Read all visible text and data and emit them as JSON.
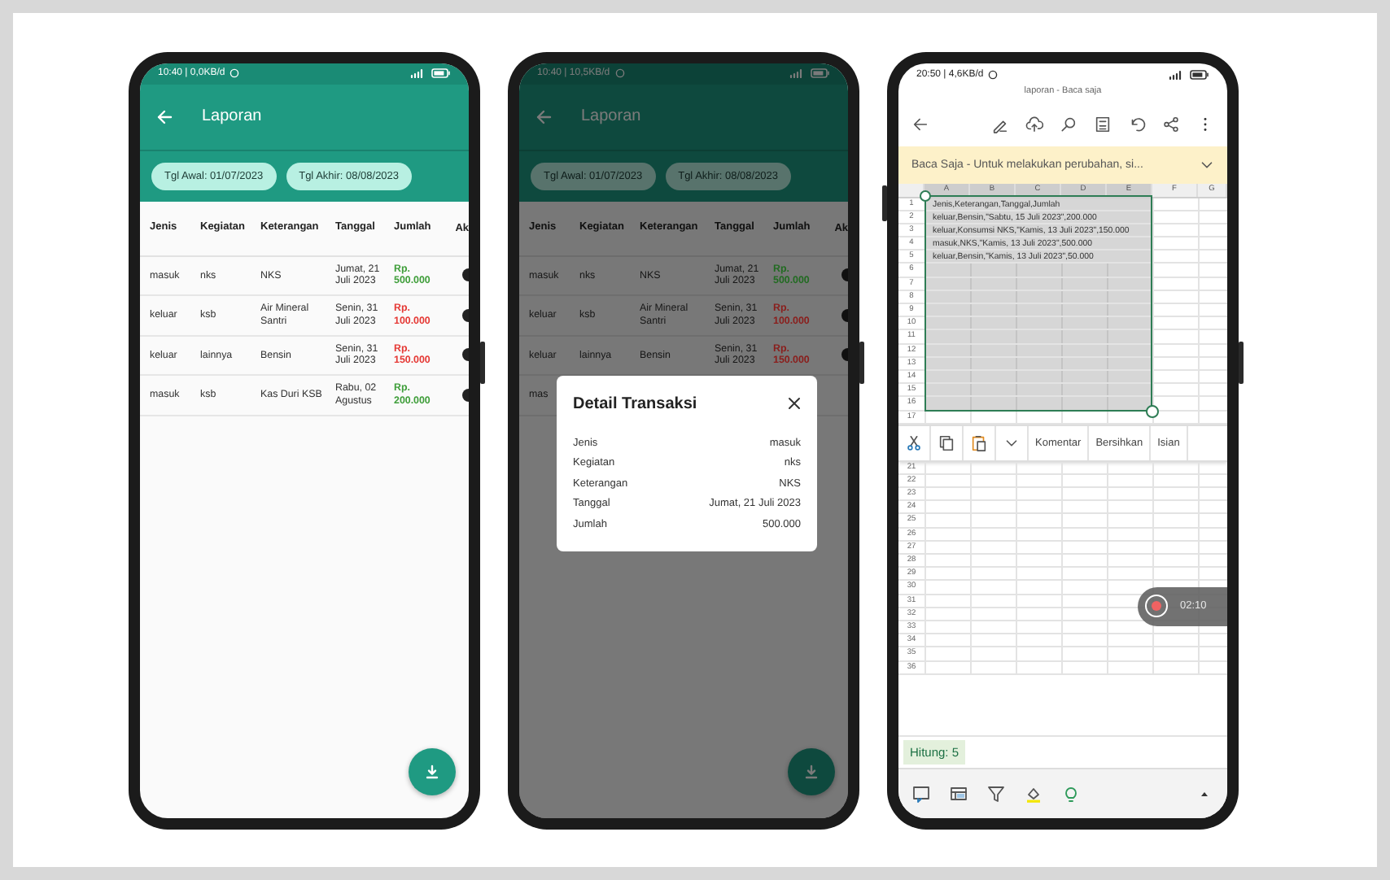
{
  "phones": [
    {
      "kind": "report",
      "dimmed": false,
      "status_bar": {
        "time": "10:40 | 0,0KB/d"
      },
      "app_bar": {
        "title": "Laporan"
      },
      "date_filters": [
        {
          "label": "Tgl Awal: 01/07/2023"
        },
        {
          "label": "Tgl Akhir: 08/08/2023"
        }
      ],
      "table": {
        "columns": [
          "Jenis",
          "Kegiatan",
          "Keterangan",
          "Tanggal",
          "Jumlah",
          "Ak"
        ],
        "rows": [
          {
            "jenis": "masuk",
            "kegiatan": "nks",
            "keterangan": "NKS",
            "tanggal": "Jumat, 21 Juli 2023",
            "jumlah": "Rp. 500.000",
            "color": "#3f9e3a"
          },
          {
            "jenis": "keluar",
            "kegiatan": "ksb",
            "keterangan": "Air Mineral Santri",
            "tanggal": "Senin, 31 Juli 2023",
            "jumlah": "Rp. 100.000",
            "color": "#e53935"
          },
          {
            "jenis": "keluar",
            "kegiatan": "lainnya",
            "keterangan": "Bensin",
            "tanggal": "Senin, 31 Juli 2023",
            "jumlah": "Rp. 150.000",
            "color": "#e53935"
          },
          {
            "jenis": "masuk",
            "kegiatan": "ksb",
            "keterangan": "Kas Duri KSB",
            "tanggal": "Rabu, 02 Agustus",
            "jumlah": "Rp. 200.000",
            "color": "#3f9e3a"
          }
        ]
      }
    },
    {
      "kind": "report",
      "dimmed": true,
      "status_bar": {
        "time": "10:40 | 10,5KB/d"
      },
      "app_bar": {
        "title": "Laporan"
      },
      "date_filters": [
        {
          "label": "Tgl Awal: 01/07/2023"
        },
        {
          "label": "Tgl Akhir: 08/08/2023"
        }
      ],
      "table": {
        "columns": [
          "Jenis",
          "Kegiatan",
          "Keterangan",
          "Tanggal",
          "Jumlah",
          "Ak"
        ],
        "rows": [
          {
            "jenis": "masuk",
            "kegiatan": "nks",
            "keterangan": "NKS",
            "tanggal": "Jumat, 21 Juli 2023",
            "jumlah": "Rp. 500.000",
            "color": "#226b22"
          },
          {
            "jenis": "keluar",
            "kegiatan": "ksb",
            "keterangan": "Air Mineral Santri",
            "tanggal": "Senin, 31 Juli 2023",
            "jumlah": "Rp. 100.000",
            "color": "#8a1e1c"
          },
          {
            "jenis": "keluar",
            "kegiatan": "lainnya",
            "keterangan": "Bensin",
            "tanggal": "Senin, 31 Juli 2023",
            "jumlah": "Rp. 150.000",
            "color": "#8a1e1c"
          },
          {
            "jenis": "mas"
          }
        ]
      },
      "dialog": {
        "title": "Detail Transaksi",
        "fields": [
          {
            "label": "Jenis",
            "value": "masuk"
          },
          {
            "label": "Kegiatan",
            "value": "nks"
          },
          {
            "label": "Keterangan",
            "value": "NKS"
          },
          {
            "label": "Tanggal",
            "value": "Jumat, 21 Juli 2023"
          },
          {
            "label": "Jumlah",
            "value": "500.000"
          }
        ]
      }
    },
    {
      "kind": "spreadsheet",
      "status_bar": {
        "time": "20:50 | 4,6KB/d"
      },
      "document_title": "laporan - Baca saja",
      "banner": {
        "text": "Baca Saja - Untuk melakukan perubahan, si..."
      },
      "grid": {
        "columns": [
          {
            "label": "A",
            "selected": true
          },
          {
            "label": "B",
            "selected": true
          },
          {
            "label": "C",
            "selected": true
          },
          {
            "label": "D",
            "selected": true
          },
          {
            "label": "E",
            "selected": true
          },
          {
            "label": "F",
            "selected": false
          },
          {
            "label": "G",
            "selected": false
          }
        ],
        "rows": [
          {
            "number": "1",
            "selected": true,
            "text": "Jenis,Keterangan,Tanggal,Jumlah"
          },
          {
            "number": "2",
            "selected": true,
            "text": "keluar,Bensin,\"Sabtu, 15 Juli 2023\",200.000"
          },
          {
            "number": "3",
            "selected": true,
            "text": "keluar,Konsumsi NKS,\"Kamis, 13 Juli 2023\",150.000"
          },
          {
            "number": "4",
            "selected": true,
            "text": "masuk,NKS,\"Kamis, 13 Juli 2023\",500.000"
          },
          {
            "number": "5",
            "selected": true,
            "text": "keluar,Bensin,\"Kamis, 13 Juli 2023\",50.000"
          },
          {
            "number": "6",
            "selected": true
          },
          {
            "number": "7",
            "selected": true
          },
          {
            "number": "8",
            "selected": true
          },
          {
            "number": "9",
            "selected": true
          },
          {
            "number": "10",
            "selected": true
          },
          {
            "number": "11",
            "selected": true
          },
          {
            "number": "12",
            "selected": true
          },
          {
            "number": "13",
            "selected": true
          },
          {
            "number": "14",
            "selected": true
          },
          {
            "number": "15",
            "selected": true
          },
          {
            "number": "16",
            "selected": true
          },
          {
            "number": "17",
            "selected": false
          }
        ],
        "rows_below": [
          {
            "number": "21"
          },
          {
            "number": "22"
          },
          {
            "number": "23"
          },
          {
            "number": "24"
          },
          {
            "number": "25"
          },
          {
            "number": "26"
          },
          {
            "number": "27"
          },
          {
            "number": "28"
          },
          {
            "number": "29"
          },
          {
            "number": "30"
          },
          {
            "number": "31"
          },
          {
            "number": "32"
          },
          {
            "number": "33"
          },
          {
            "number": "34"
          },
          {
            "number": "35"
          },
          {
            "number": "36"
          }
        ]
      },
      "context_menu": {
        "items": [
          "Komentar",
          "Bersihkan",
          "Isian"
        ]
      },
      "recording": {
        "time": "02:10"
      },
      "status": {
        "text": "Hitung: 5"
      }
    }
  ]
}
